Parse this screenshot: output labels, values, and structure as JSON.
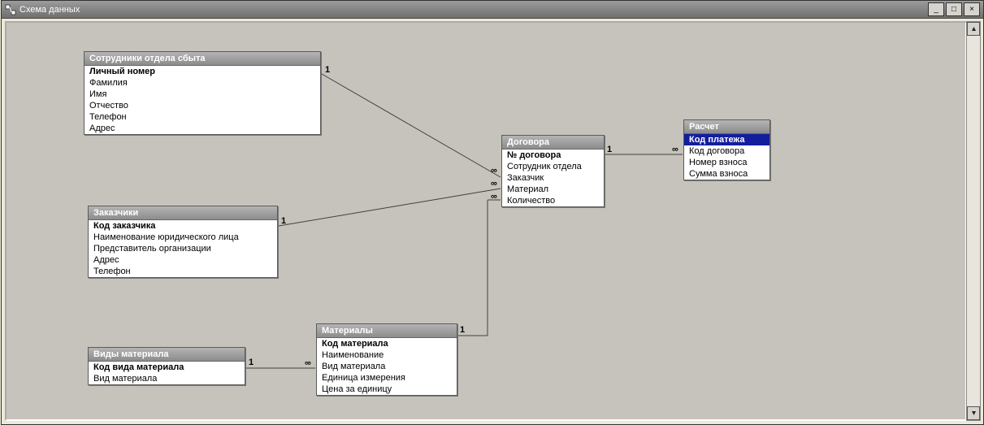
{
  "window": {
    "title": "Схема данных"
  },
  "winbtns": {
    "min": "_",
    "max": "□",
    "close": "×"
  },
  "tables": {
    "t1": {
      "title": "Сотрудники отдела сбыта",
      "fields": [
        "Личный номер",
        "Фамилия",
        "Имя",
        "Отчество",
        "Телефон",
        "Адрес"
      ]
    },
    "t2": {
      "title": "Заказчики",
      "fields": [
        "Код заказчика",
        "Наименование юридического лица",
        "Представитель организации",
        "Адрес",
        "Телефон"
      ]
    },
    "t3": {
      "title": "Виды материала",
      "fields": [
        "Код вида материала",
        "Вид материала"
      ]
    },
    "t4": {
      "title": "Материалы",
      "fields": [
        "Код материала",
        "Наименование",
        "Вид материала",
        "Единица измерения",
        "Цена за единицу"
      ]
    },
    "t5": {
      "title": "Договора",
      "fields": [
        "№ договора",
        "Сотрудник отдела",
        "Заказчик",
        "Материал",
        "Количество"
      ]
    },
    "t6": {
      "title": "Расчет",
      "fields": [
        "Код платежа",
        "Код договора",
        "Номер взноса",
        "Сумма взноса"
      ]
    }
  },
  "rel": {
    "one": "1",
    "many": "∞"
  }
}
